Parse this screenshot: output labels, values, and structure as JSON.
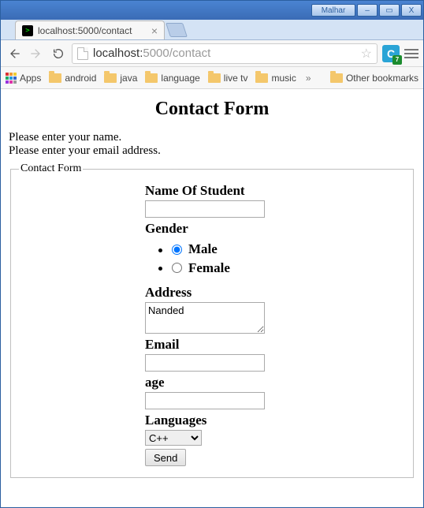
{
  "window": {
    "user_label": "Malhar",
    "min_glyph": "–",
    "max_glyph": "▭",
    "close_glyph": "X"
  },
  "tab": {
    "title": "localhost:5000/contact",
    "close_glyph": "×"
  },
  "omnibox": {
    "host": "localhost:",
    "port_path": "5000/contact"
  },
  "ext": {
    "letter": "C",
    "badge": "7"
  },
  "bookmarks": {
    "apps": "Apps",
    "items": [
      "android",
      "java",
      "language",
      "live tv",
      "music"
    ],
    "overflow_glyph": "»",
    "other": "Other bookmarks"
  },
  "page": {
    "title": "Contact Form",
    "errors": [
      "Please enter your name.",
      "Please enter your email address."
    ],
    "legend": "Contact Form",
    "labels": {
      "name": "Name Of Student",
      "gender": "Gender",
      "address": "Address",
      "email": "Email",
      "age": "age",
      "languages": "Languages"
    },
    "gender_options": {
      "male": "Male",
      "female": "Female"
    },
    "gender_selected": "male",
    "values": {
      "name": "",
      "address": "Nanded",
      "email": "",
      "age": "",
      "language": "C++"
    },
    "submit_label": "Send"
  }
}
